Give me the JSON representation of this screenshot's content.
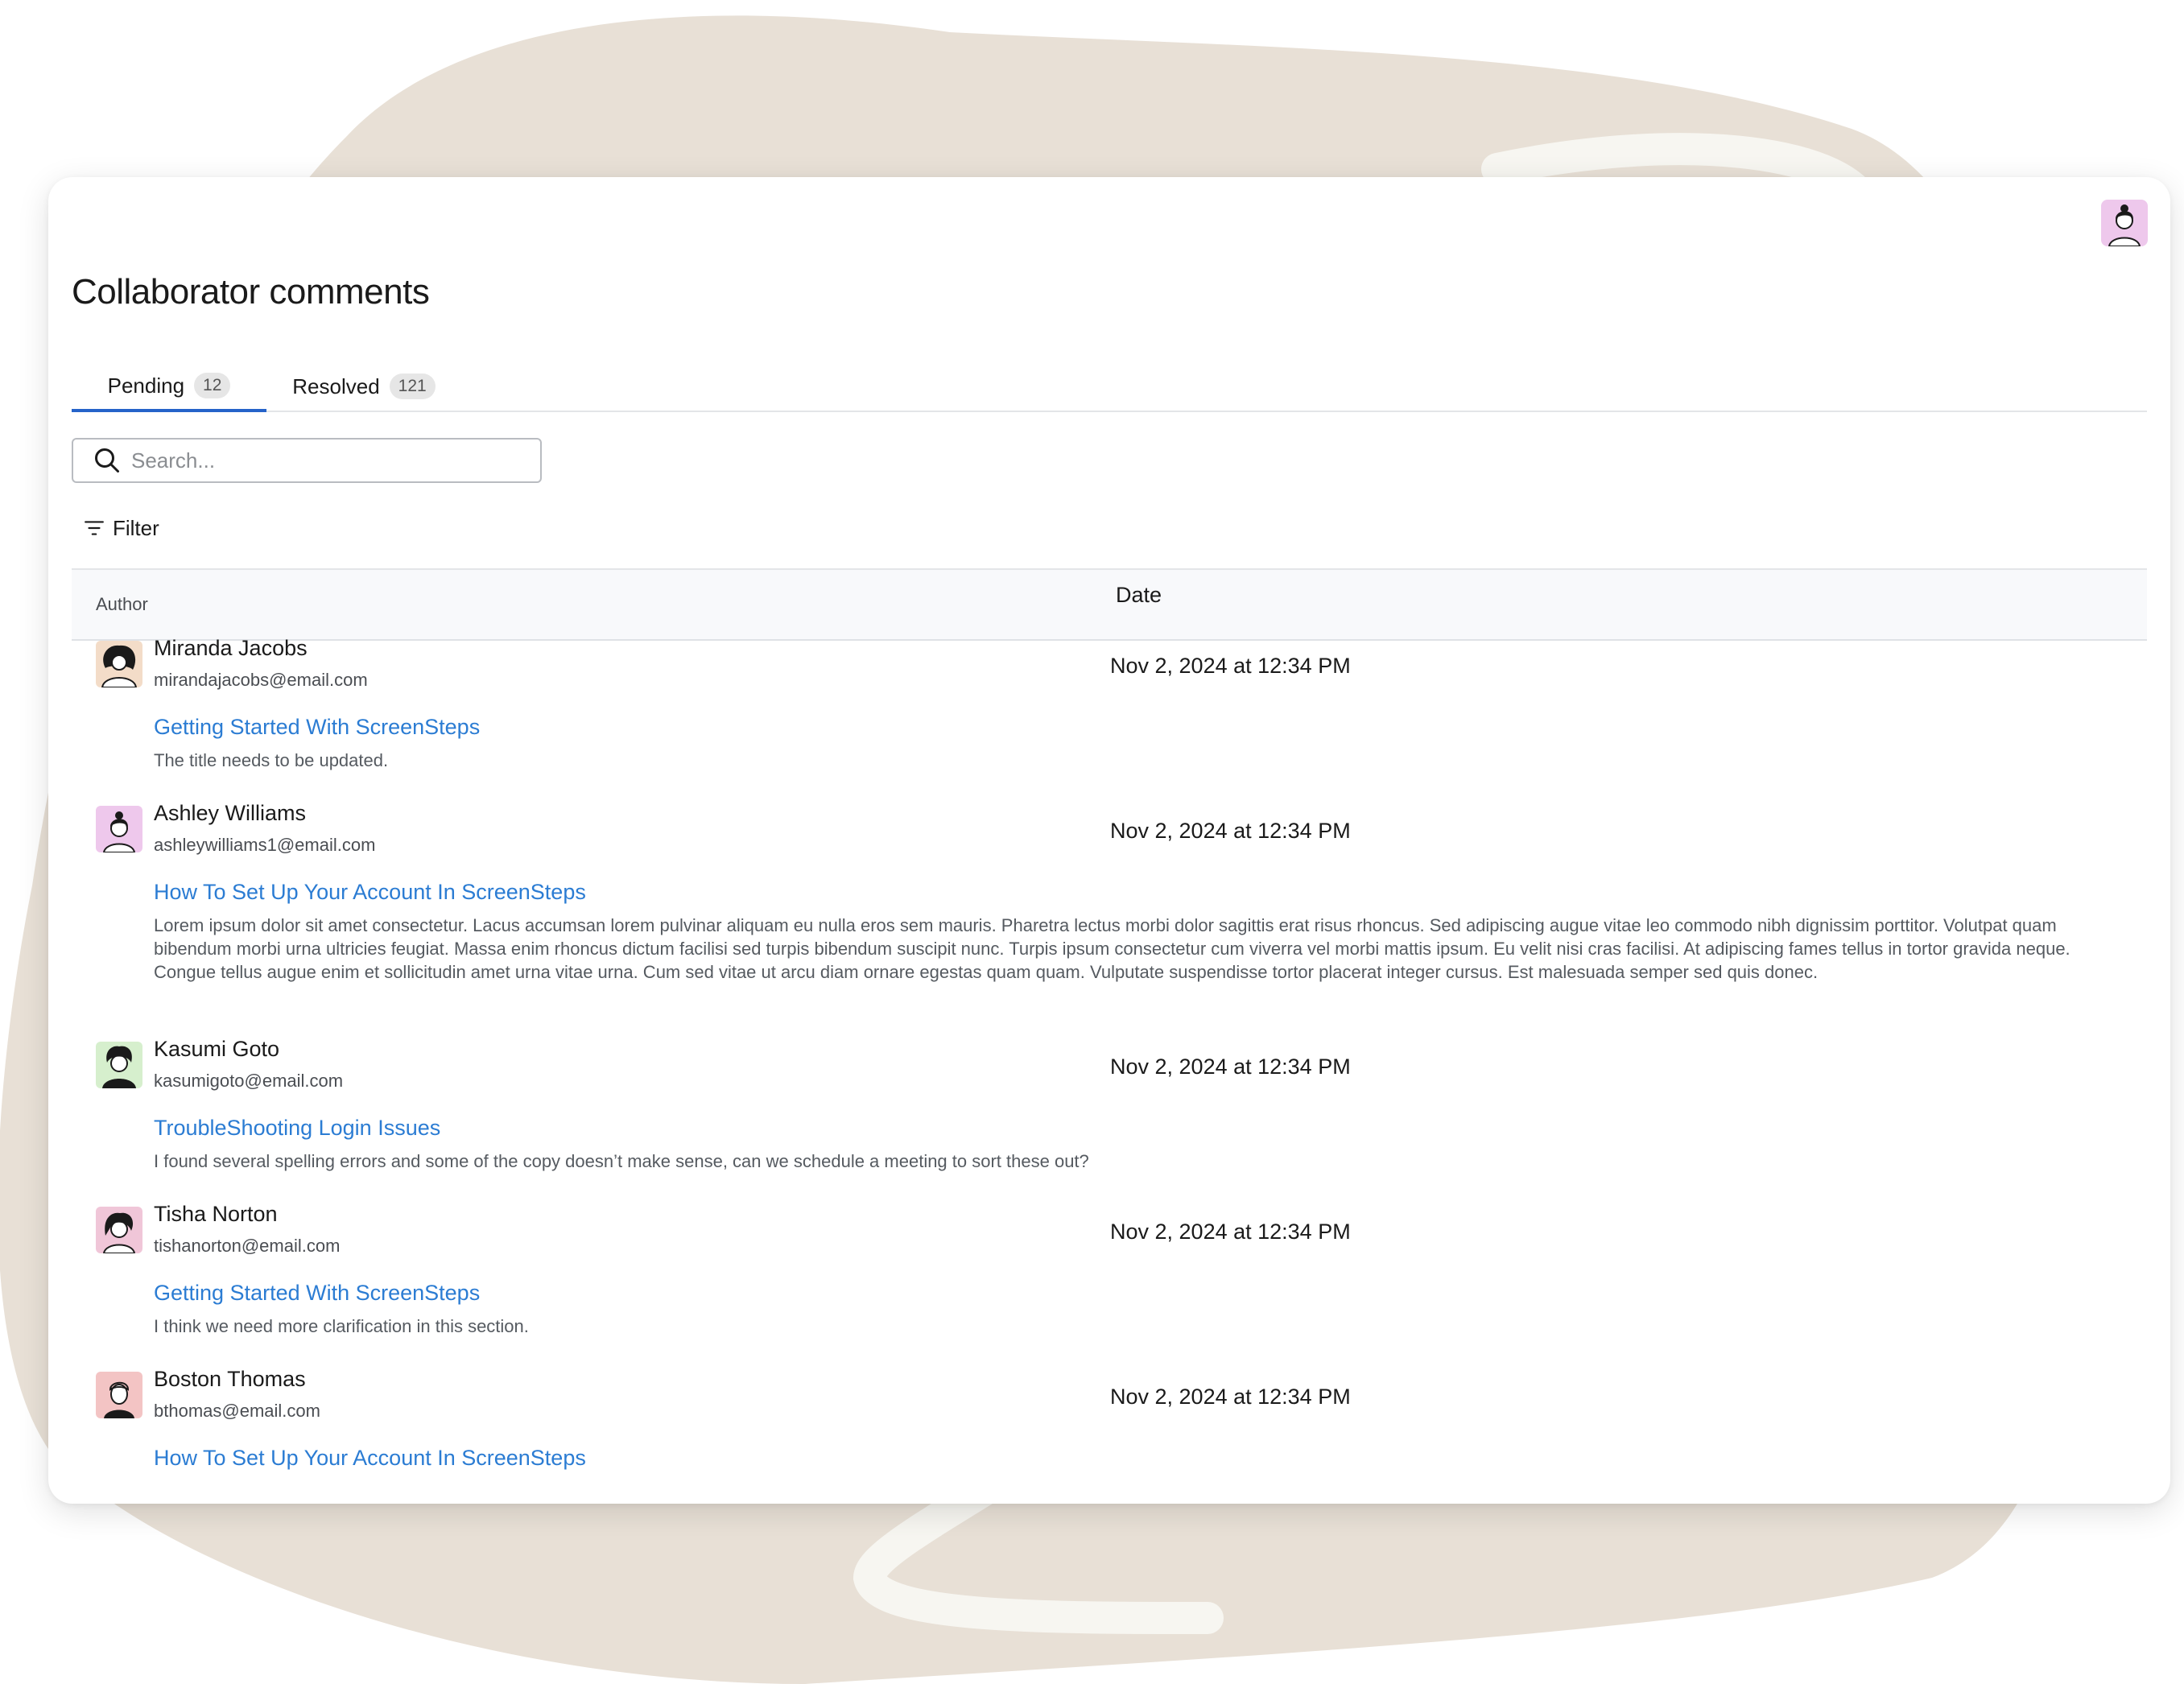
{
  "page": {
    "title": "Collaborator comments"
  },
  "colors": {
    "accent": "#2563c9",
    "link": "#2b7cd3",
    "background_blob": "#e8e0d6",
    "background_swoosh": "#f7f6f1"
  },
  "tabs": [
    {
      "label": "Pending",
      "count": "12",
      "active": true
    },
    {
      "label": "Resolved",
      "count": "121",
      "active": false
    }
  ],
  "search": {
    "placeholder": "Search...",
    "value": "",
    "icon": "search-icon"
  },
  "filter": {
    "label": "Filter",
    "icon": "filter-icon"
  },
  "table": {
    "columns": [
      "Author",
      "Date"
    ],
    "rows": [
      {
        "name": "Miranda Jacobs",
        "email": "mirandajacobs@email.com",
        "date": "Nov 2, 2024 at 12:34 PM",
        "doc_title": "Getting Started With ScreenSteps",
        "comment": "The title needs to be updated.",
        "avatar_color": "#f3dcc8"
      },
      {
        "name": "Ashley Williams",
        "email": "ashleywilliams1@email.com",
        "date": "Nov 2, 2024 at 12:34 PM",
        "doc_title": "How To Set Up Your Account In ScreenSteps",
        "comment": "Lorem ipsum dolor sit amet consectetur. Lacus accumsan lorem pulvinar aliquam eu nulla eros sem mauris. Pharetra lectus morbi dolor sagittis erat risus rhoncus. Sed adipiscing augue vitae leo commodo nibh dignissim porttitor. Volutpat quam bibendum morbi urna ultricies feugiat. Massa enim rhoncus dictum facilisi sed turpis bibendum suscipit nunc. Turpis ipsum consectetur cum viverra vel morbi mattis ipsum. Eu velit nisi cras facilisi. At adipiscing fames tellus in tortor gravida neque. Congue tellus augue enim et sollicitudin amet urna vitae urna. Cum sed vitae ut arcu diam ornare egestas quam quam. Vulputate suspendisse tortor placerat integer cursus. Est malesuada semper sed quis donec.",
        "avatar_color": "#eec8ec"
      },
      {
        "name": "Kasumi Goto",
        "email": "kasumigoto@email.com",
        "date": "Nov 2, 2024 at 12:34 PM",
        "doc_title": "TroubleShooting Login Issues",
        "comment": "I found several spelling errors and some of the copy doesn’t make sense, can we schedule a meeting to sort these out?",
        "avatar_color": "#d6efcd"
      },
      {
        "name": "Tisha Norton",
        "email": "tishanorton@email.com",
        "date": "Nov 2, 2024 at 12:34 PM",
        "doc_title": "Getting Started With ScreenSteps",
        "comment": "I think we need more clarification in this section.",
        "avatar_color": "#f0c6d8"
      },
      {
        "name": "Boston Thomas",
        "email": "bthomas@email.com",
        "date": "Nov 2, 2024 at 12:34 PM",
        "doc_title": "How To Set Up Your Account In ScreenSteps",
        "comment": "",
        "avatar_color": "#f3c4c4"
      }
    ]
  }
}
